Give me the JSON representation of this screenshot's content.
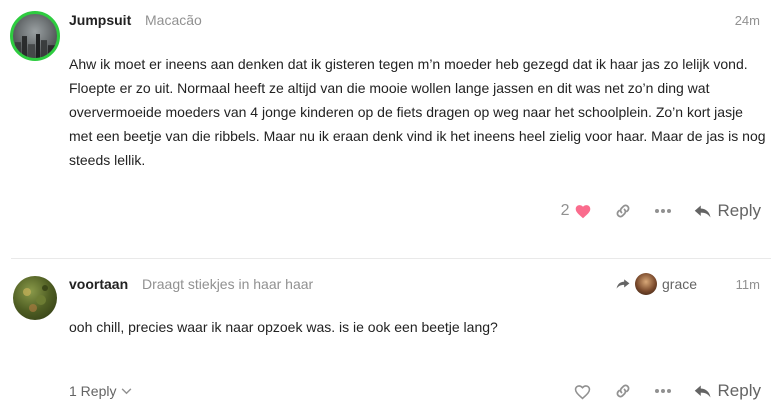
{
  "posts": [
    {
      "username": "Jumpsuit",
      "user_title": "Macacão",
      "time": "24m",
      "text": "Ahw ik moet er ineens aan denken dat ik gisteren tegen m’n moeder heb gezegd dat ik haar jas zo lelijk vond. Floepte er zo uit. Normaal heeft ze altijd van die mooie wollen lange jassen en dit was net zo’n ding wat oververmoeide moeders van 4 jonge kinderen op de fiets dragen op weg naar het schoolplein. Zo’n kort jasje met een beetje van die ribbels. Maar nu ik eraan denk vind ik het ineens heel zielig voor haar. Maar de jas is nog steeds lellik.",
      "like_count": "2",
      "liked_color": "#fa6c8d",
      "reply_label": "Reply"
    },
    {
      "username": "voortaan",
      "user_title": "Draagt stiekjes in haar haar",
      "time": "11m",
      "reply_to_user": "grace",
      "text": "ooh chill, precies waar ik naar opzoek was. is ie ook een beetje lang?",
      "replies_label": "1 Reply",
      "reply_label": "Reply"
    }
  ],
  "icons": {
    "heart": "heart-icon",
    "link": "link-icon",
    "more": "ellipsis-icon",
    "reply": "reply-icon",
    "chevron": "chevron-down-icon",
    "share_arrow": "reply-arrow-icon"
  },
  "colors": {
    "muted": "#919191",
    "text": "#222222",
    "online_ring": "#2ecc40"
  }
}
